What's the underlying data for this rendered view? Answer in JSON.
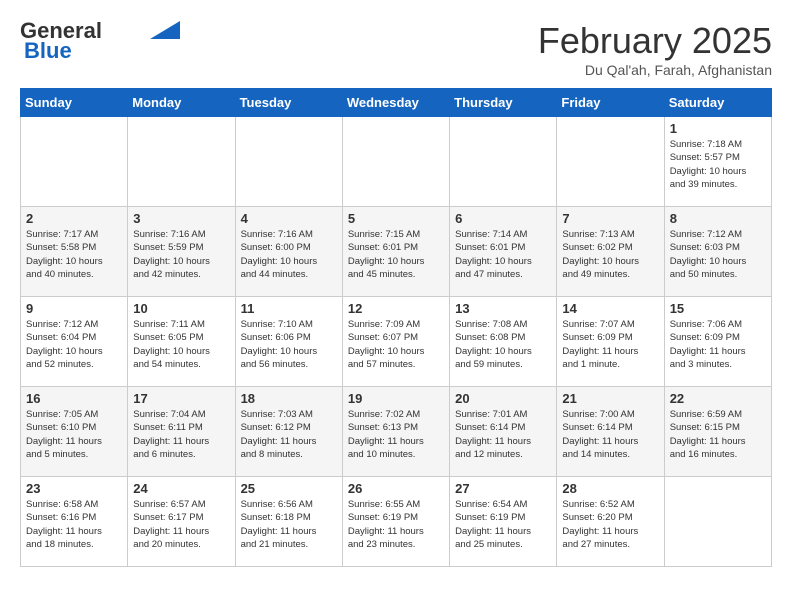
{
  "header": {
    "logo_general": "General",
    "logo_blue": "Blue",
    "month_title": "February 2025",
    "location": "Du Qal'ah, Farah, Afghanistan"
  },
  "weekdays": [
    "Sunday",
    "Monday",
    "Tuesday",
    "Wednesday",
    "Thursday",
    "Friday",
    "Saturday"
  ],
  "weeks": [
    [
      {
        "day": "",
        "info": ""
      },
      {
        "day": "",
        "info": ""
      },
      {
        "day": "",
        "info": ""
      },
      {
        "day": "",
        "info": ""
      },
      {
        "day": "",
        "info": ""
      },
      {
        "day": "",
        "info": ""
      },
      {
        "day": "1",
        "info": "Sunrise: 7:18 AM\nSunset: 5:57 PM\nDaylight: 10 hours\nand 39 minutes."
      }
    ],
    [
      {
        "day": "2",
        "info": "Sunrise: 7:17 AM\nSunset: 5:58 PM\nDaylight: 10 hours\nand 40 minutes."
      },
      {
        "day": "3",
        "info": "Sunrise: 7:16 AM\nSunset: 5:59 PM\nDaylight: 10 hours\nand 42 minutes."
      },
      {
        "day": "4",
        "info": "Sunrise: 7:16 AM\nSunset: 6:00 PM\nDaylight: 10 hours\nand 44 minutes."
      },
      {
        "day": "5",
        "info": "Sunrise: 7:15 AM\nSunset: 6:01 PM\nDaylight: 10 hours\nand 45 minutes."
      },
      {
        "day": "6",
        "info": "Sunrise: 7:14 AM\nSunset: 6:01 PM\nDaylight: 10 hours\nand 47 minutes."
      },
      {
        "day": "7",
        "info": "Sunrise: 7:13 AM\nSunset: 6:02 PM\nDaylight: 10 hours\nand 49 minutes."
      },
      {
        "day": "8",
        "info": "Sunrise: 7:12 AM\nSunset: 6:03 PM\nDaylight: 10 hours\nand 50 minutes."
      }
    ],
    [
      {
        "day": "9",
        "info": "Sunrise: 7:12 AM\nSunset: 6:04 PM\nDaylight: 10 hours\nand 52 minutes."
      },
      {
        "day": "10",
        "info": "Sunrise: 7:11 AM\nSunset: 6:05 PM\nDaylight: 10 hours\nand 54 minutes."
      },
      {
        "day": "11",
        "info": "Sunrise: 7:10 AM\nSunset: 6:06 PM\nDaylight: 10 hours\nand 56 minutes."
      },
      {
        "day": "12",
        "info": "Sunrise: 7:09 AM\nSunset: 6:07 PM\nDaylight: 10 hours\nand 57 minutes."
      },
      {
        "day": "13",
        "info": "Sunrise: 7:08 AM\nSunset: 6:08 PM\nDaylight: 10 hours\nand 59 minutes."
      },
      {
        "day": "14",
        "info": "Sunrise: 7:07 AM\nSunset: 6:09 PM\nDaylight: 11 hours\nand 1 minute."
      },
      {
        "day": "15",
        "info": "Sunrise: 7:06 AM\nSunset: 6:09 PM\nDaylight: 11 hours\nand 3 minutes."
      }
    ],
    [
      {
        "day": "16",
        "info": "Sunrise: 7:05 AM\nSunset: 6:10 PM\nDaylight: 11 hours\nand 5 minutes."
      },
      {
        "day": "17",
        "info": "Sunrise: 7:04 AM\nSunset: 6:11 PM\nDaylight: 11 hours\nand 6 minutes."
      },
      {
        "day": "18",
        "info": "Sunrise: 7:03 AM\nSunset: 6:12 PM\nDaylight: 11 hours\nand 8 minutes."
      },
      {
        "day": "19",
        "info": "Sunrise: 7:02 AM\nSunset: 6:13 PM\nDaylight: 11 hours\nand 10 minutes."
      },
      {
        "day": "20",
        "info": "Sunrise: 7:01 AM\nSunset: 6:14 PM\nDaylight: 11 hours\nand 12 minutes."
      },
      {
        "day": "21",
        "info": "Sunrise: 7:00 AM\nSunset: 6:14 PM\nDaylight: 11 hours\nand 14 minutes."
      },
      {
        "day": "22",
        "info": "Sunrise: 6:59 AM\nSunset: 6:15 PM\nDaylight: 11 hours\nand 16 minutes."
      }
    ],
    [
      {
        "day": "23",
        "info": "Sunrise: 6:58 AM\nSunset: 6:16 PM\nDaylight: 11 hours\nand 18 minutes."
      },
      {
        "day": "24",
        "info": "Sunrise: 6:57 AM\nSunset: 6:17 PM\nDaylight: 11 hours\nand 20 minutes."
      },
      {
        "day": "25",
        "info": "Sunrise: 6:56 AM\nSunset: 6:18 PM\nDaylight: 11 hours\nand 21 minutes."
      },
      {
        "day": "26",
        "info": "Sunrise: 6:55 AM\nSunset: 6:19 PM\nDaylight: 11 hours\nand 23 minutes."
      },
      {
        "day": "27",
        "info": "Sunrise: 6:54 AM\nSunset: 6:19 PM\nDaylight: 11 hours\nand 25 minutes."
      },
      {
        "day": "28",
        "info": "Sunrise: 6:52 AM\nSunset: 6:20 PM\nDaylight: 11 hours\nand 27 minutes."
      },
      {
        "day": "",
        "info": ""
      }
    ]
  ]
}
